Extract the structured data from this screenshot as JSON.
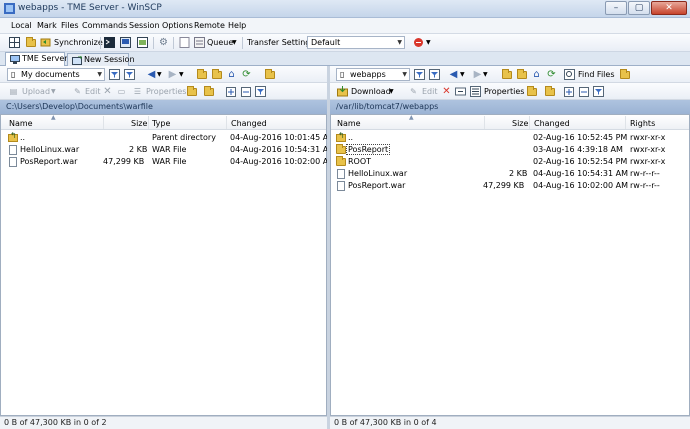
{
  "window": {
    "title": "webapps - TME Server - WinSCP",
    "minimize": "–",
    "maximize": "▢",
    "close": "✕"
  },
  "menu": [
    "Local",
    "Mark",
    "Files",
    "Commands",
    "Session",
    "Options",
    "Remote",
    "Help"
  ],
  "toolbar": {
    "synchronize": "Synchronize",
    "queue": "Queue",
    "transfer_label": "Transfer Settings",
    "transfer_value": "Default"
  },
  "tabs": [
    {
      "label": "TME Server"
    },
    {
      "label": "New Session"
    }
  ],
  "left": {
    "location": "My documents",
    "upload": "Upload",
    "edit": "Edit",
    "properties": "Properties",
    "path": "C:\\Users\\Develop\\Documents\\warfile",
    "columns": {
      "name": "Name",
      "size": "Size",
      "type": "Type",
      "changed": "Changed"
    },
    "rows": [
      {
        "name": "..",
        "size": "",
        "type": "Parent directory",
        "changed": "04-Aug-2016  10:01:45 A...",
        "icon": "up"
      },
      {
        "name": "HelloLinux.war",
        "size": "2 KB",
        "type": "WAR File",
        "changed": "04-Aug-2016  10:54:31 A...",
        "icon": "file"
      },
      {
        "name": "PosReport.war",
        "size": "47,299 KB",
        "type": "WAR File",
        "changed": "04-Aug-2016  10:02:00 A...",
        "icon": "file"
      }
    ],
    "status": "0 B of 47,300 KB in 0 of 2"
  },
  "right": {
    "location": "webapps",
    "download": "Download",
    "edit": "Edit",
    "properties": "Properties",
    "find": "Find Files",
    "path": "/var/lib/tomcat7/webapps",
    "columns": {
      "name": "Name",
      "size": "Size",
      "changed": "Changed",
      "rights": "Rights"
    },
    "rows": [
      {
        "name": "..",
        "size": "",
        "changed": "02-Aug-16 10:52:45 PM",
        "rights": "rwxr-xr-x",
        "icon": "up"
      },
      {
        "name": "PosReport",
        "size": "",
        "changed": "03-Aug-16 4:39:18 AM",
        "rights": "rwxr-xr-x",
        "icon": "folder"
      },
      {
        "name": "ROOT",
        "size": "",
        "changed": "02-Aug-16 10:52:54 PM",
        "rights": "rwxr-xr-x",
        "icon": "folder"
      },
      {
        "name": "HelloLinux.war",
        "size": "2 KB",
        "changed": "04-Aug-16 10:54:31 AM",
        "rights": "rw-r--r--",
        "icon": "file"
      },
      {
        "name": "PosReport.war",
        "size": "47,299 KB",
        "changed": "04-Aug-16 10:02:00 AM",
        "rights": "rw-r--r--",
        "icon": "file"
      }
    ],
    "status": "0 B of 47,300 KB in 0 of 4"
  },
  "colors": {
    "accent": "#aec3df",
    "folder": "#e8c24a"
  }
}
